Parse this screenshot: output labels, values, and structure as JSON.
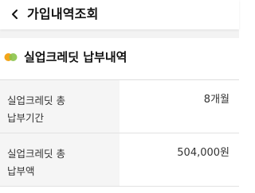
{
  "header": {
    "title": "가입내역조회",
    "back_icon": "chevron-left-icon"
  },
  "section": {
    "title": "실업크레딧 납부내역",
    "icon": "orange-green-dots-icon",
    "icon_colors": [
      "#f2a51a",
      "#8bc34a"
    ]
  },
  "rows": [
    {
      "label": "실업크레딧 총\n납부기간",
      "value": "8개월"
    },
    {
      "label": "실업크레딧 총\n납부액",
      "value": "504,000원"
    }
  ]
}
